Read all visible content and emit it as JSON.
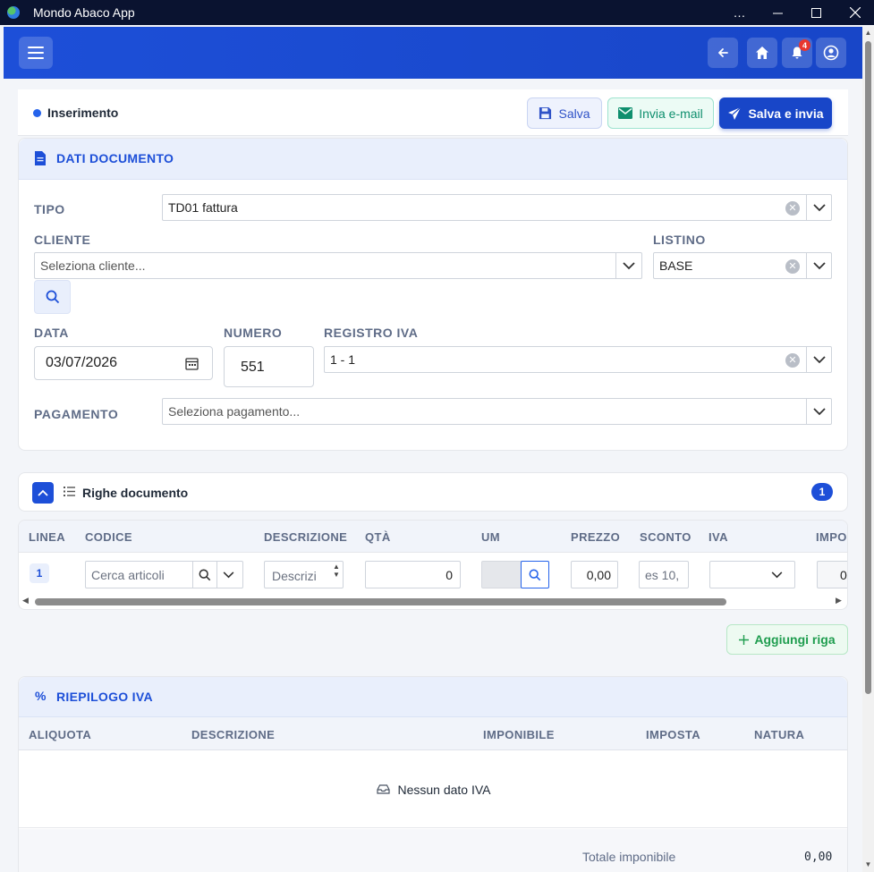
{
  "window": {
    "title": "Mondo Abaco App",
    "controls": [
      "…",
      "—",
      "☐",
      "✕"
    ]
  },
  "header": {
    "notifications_count": "4"
  },
  "actions": {
    "status": "Inserimento",
    "save_label": "Salva",
    "email_label": "Invia e-mail",
    "send_label": "Salva e invia"
  },
  "documento": {
    "title": "DATI DOCUMENTO",
    "tipo_label": "TIPO",
    "tipo_value": "TD01 fattura",
    "cliente_label": "CLIENTE",
    "cliente_placeholder": "Seleziona cliente...",
    "listino_label": "LISTINO",
    "listino_value": "BASE",
    "data_label": "DATA",
    "data_value": "03/07/2026",
    "numero_label": "NUMERO",
    "numero_value": "551",
    "registro_label": "REGISTRO IVA",
    "registro_value": "1 - 1",
    "pagamento_label": "PAGAMENTO",
    "pagamento_placeholder": "Seleziona pagamento..."
  },
  "righe": {
    "title": "Righe documento",
    "count": "1",
    "columns": [
      "LINEA",
      "CODICE",
      "DESCRIZIONE",
      "QTÀ",
      "UM",
      "PREZZO",
      "SCONTO",
      "IVA",
      "IMPO"
    ],
    "row": {
      "linea": "1",
      "codice_placeholder": "Cerca articoli",
      "descrizione_placeholder": "Descrizi",
      "qta": "0",
      "prezzo": "0,00",
      "sconto_placeholder": "es 10,",
      "importo": "0"
    },
    "add_label": "Aggiungi riga"
  },
  "iva": {
    "title": "RIEPILOGO IVA",
    "columns": [
      "ALIQUOTA",
      "DESCRIZIONE",
      "IMPONIBILE",
      "IMPOSTA",
      "NATURA"
    ],
    "empty": "Nessun dato IVA",
    "totale_label": "Totale imponibile",
    "totale_value": "0,00"
  }
}
